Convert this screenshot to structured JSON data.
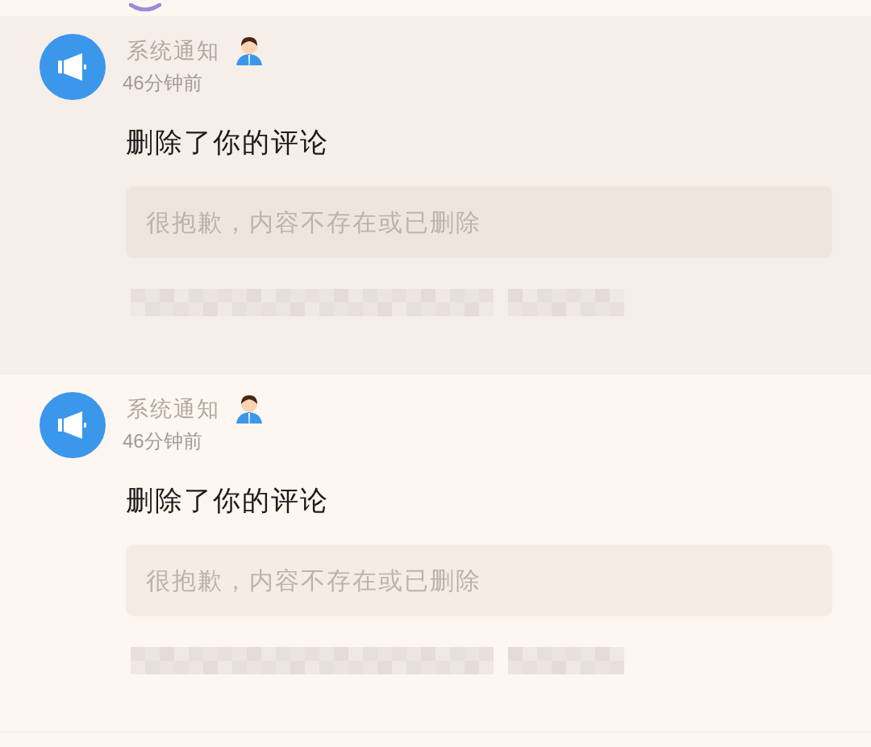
{
  "notifications": [
    {
      "sender": "系统通知",
      "time": "46分钟前",
      "message": "删除了你的评论",
      "quote": "很抱歉，内容不存在或已删除",
      "color": "#f6eee9"
    },
    {
      "sender": "系统通知",
      "time": "46分钟前",
      "message": "删除了你的评论",
      "quote": "很抱歉，内容不存在或已删除",
      "color": "#fdf6f1"
    }
  ]
}
